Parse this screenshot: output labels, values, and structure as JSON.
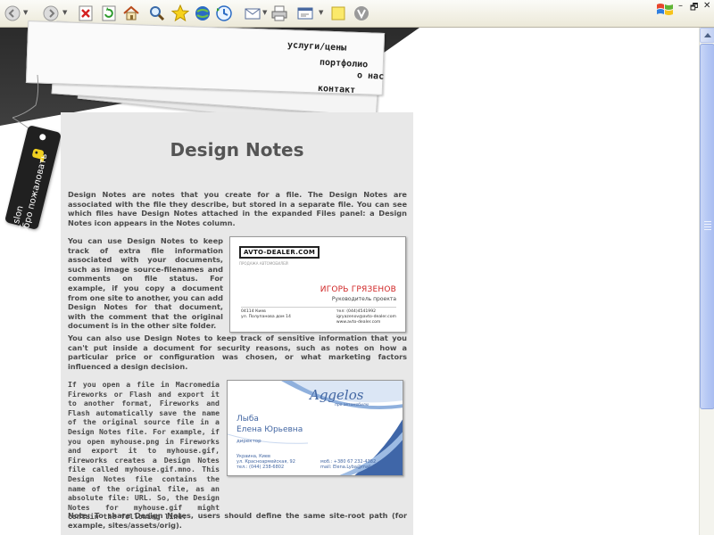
{
  "browser": {
    "toolbar_icons": [
      "back-icon",
      "forward-icon",
      "stop-icon",
      "refresh-icon",
      "home-icon",
      "search-icon",
      "favorites-icon",
      "media-icon",
      "history-icon",
      "mail-icon",
      "print-icon",
      "edit-icon",
      "notes-icon",
      "messenger-icon"
    ],
    "window_controls": {
      "minimize": "–",
      "restore": "🗗",
      "close": "✕"
    }
  },
  "nav": {
    "items": [
      {
        "label": "услуги/цены"
      },
      {
        "label": "портфолио"
      },
      {
        "label": "о нас"
      },
      {
        "label": "контакт"
      }
    ]
  },
  "tag": {
    "line1": "ra_slon",
    "line2": "добро пожаловать"
  },
  "content": {
    "title": "Design Notes",
    "p1": "Design Notes are notes that you create for a file. The Design Notes are associated with the file they describe, but stored in a separate file. You can see which files have Design Notes attached in the expanded Files panel: a Design Notes icon appears in the Notes column.",
    "p2": "You can use Design Notes to keep track of extra file information associated with your documents, such as image source-filenames and comments on file status. For example, if you copy a document from one site to another, you can add Design Notes for that document, with the comment that the original document is in the other site folder.",
    "p3": "You can also use Design Notes to keep track of sensitive information that you can't put inside a document for security reasons, such as notes on how a particular price or configuration was chosen, or what marketing factors influenced a design decision.",
    "p4": "If you open a file in Macromedia Fireworks or Flash and export it to another format, Fireworks and Flash automatically save the name of the original source file in a Design Notes file. For example, if you open myhouse.png in Fireworks and export it to myhouse.gif, Fireworks creates a Design Notes file called myhouse.gif.mno. This Design Notes file contains the name of the original file, as an absolute file: URL. So, the Design Notes for myhouse.gif might contain the following line:",
    "p5": "Note: To share Design Notes, users should define the same site-root path (for example, sites/assets/orig)."
  },
  "card1": {
    "logo": "AVTO-DEALER.COM",
    "logo_tag": "ПРОДАЖА АВТОМОБИЛЕЙ",
    "name": "ИГОРЬ ГРЯЗЕНОВ",
    "role": "Руководитель проекта",
    "addr1": "04114 Киев",
    "addr2": "ул. Полупанова дом 14",
    "phone": "тел: (044)4541992",
    "email": "igryazenov@avto-dealer.com",
    "site": "www.avto-dealer.com"
  },
  "card2": {
    "logo": "Aggelos",
    "logo_tag": "про автомобилю",
    "name1": "Лыба",
    "name2": "Елена Юрьевна",
    "role": "директор",
    "addr1": "Украина, Киев",
    "addr2": "ул. Красноармейская, 92",
    "phone": "тел.: (044) 238-6802",
    "mobile": "моб.: +380 67 232-4382",
    "email": "mail: Elena.Lyba@mail.ru"
  },
  "colors": {
    "dark_bar": "#2b2b2b",
    "panel": "#e8e8e8",
    "title": "#555555",
    "card1_accent": "#d02525",
    "card2_accent": "#4367a3",
    "scroll_thumb": "#b6c8f4"
  }
}
